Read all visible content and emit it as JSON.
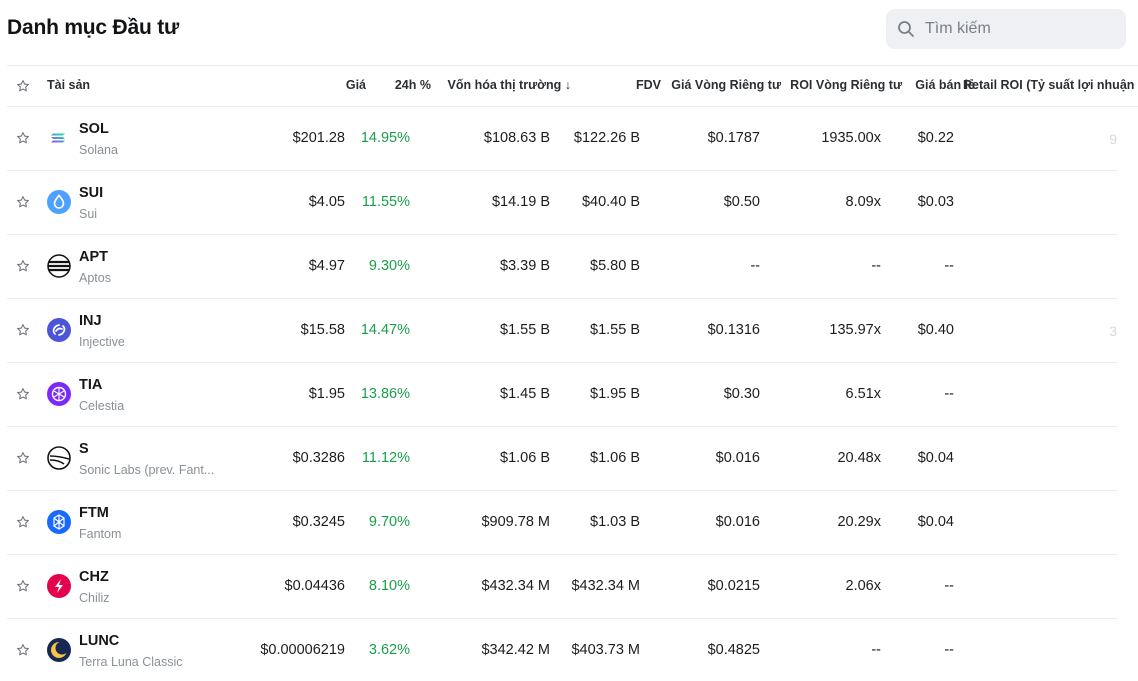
{
  "header": {
    "title": "Danh mục Đầu tư",
    "search_placeholder": "Tìm kiếm"
  },
  "table": {
    "columns": {
      "asset": "Tài sản",
      "price": "Giá",
      "change_24h": "24h %",
      "market_cap": "Vốn hóa thị trường ↓",
      "fdv": "FDV",
      "private_price": "Giá Vòng Riêng tư",
      "private_roi": "ROI Vòng Riêng tư",
      "retail_price": "Giá bán lẻ",
      "retail_roi": "Retail ROI (Tỷ suất lợi nhuận"
    },
    "rows": [
      {
        "symbol": "SOL",
        "name": "Solana",
        "price": "$201.28",
        "change": "14.95%",
        "mcap": "$108.63 B",
        "fdv": "$122.26 B",
        "private_price": "$0.1787",
        "private_roi": "1935.00x",
        "retail_price": "$0.22",
        "retail_roi": "9"
      },
      {
        "symbol": "SUI",
        "name": "Sui",
        "price": "$4.05",
        "change": "11.55%",
        "mcap": "$14.19 B",
        "fdv": "$40.40 B",
        "private_price": "$0.50",
        "private_roi": "8.09x",
        "retail_price": "$0.03",
        "retail_roi": ""
      },
      {
        "symbol": "APT",
        "name": "Aptos",
        "price": "$4.97",
        "change": "9.30%",
        "mcap": "$3.39 B",
        "fdv": "$5.80 B",
        "private_price": "--",
        "private_roi": "--",
        "retail_price": "--",
        "retail_roi": ""
      },
      {
        "symbol": "INJ",
        "name": "Injective",
        "price": "$15.58",
        "change": "14.47%",
        "mcap": "$1.55 B",
        "fdv": "$1.55 B",
        "private_price": "$0.1316",
        "private_roi": "135.97x",
        "retail_price": "$0.40",
        "retail_roi": "3"
      },
      {
        "symbol": "TIA",
        "name": "Celestia",
        "price": "$1.95",
        "change": "13.86%",
        "mcap": "$1.45 B",
        "fdv": "$1.95 B",
        "private_price": "$0.30",
        "private_roi": "6.51x",
        "retail_price": "--",
        "retail_roi": ""
      },
      {
        "symbol": "S",
        "name": "Sonic Labs (prev. Fant...",
        "price": "$0.3286",
        "change": "11.12%",
        "mcap": "$1.06 B",
        "fdv": "$1.06 B",
        "private_price": "$0.016",
        "private_roi": "20.48x",
        "retail_price": "$0.04",
        "retail_roi": ""
      },
      {
        "symbol": "FTM",
        "name": "Fantom",
        "price": "$0.3245",
        "change": "9.70%",
        "mcap": "$909.78 M",
        "fdv": "$1.03 B",
        "private_price": "$0.016",
        "private_roi": "20.29x",
        "retail_price": "$0.04",
        "retail_roi": ""
      },
      {
        "symbol": "CHZ",
        "name": "Chiliz",
        "price": "$0.04436",
        "change": "8.10%",
        "mcap": "$432.34 M",
        "fdv": "$432.34 M",
        "private_price": "$0.0215",
        "private_roi": "2.06x",
        "retail_price": "--",
        "retail_roi": ""
      },
      {
        "symbol": "LUNC",
        "name": "Terra Luna Classic",
        "price": "$0.00006219",
        "change": "3.62%",
        "mcap": "$342.42 M",
        "fdv": "$403.73 M",
        "private_price": "$0.4825",
        "private_roi": "--",
        "retail_price": "--",
        "retail_roi": ""
      }
    ]
  },
  "colors": {
    "positive": "#1a9e4b",
    "search_bg": "#eef0f3"
  }
}
